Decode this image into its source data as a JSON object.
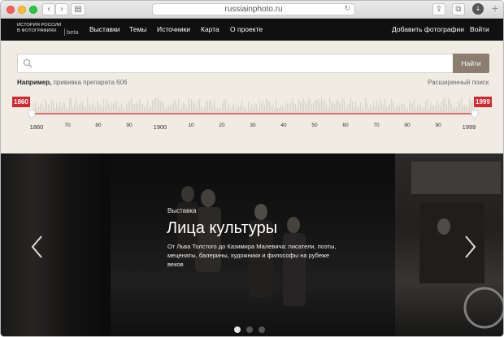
{
  "browser": {
    "url": "russiainphoto.ru",
    "back_icon": "chevron-left-icon",
    "forward_icon": "chevron-right-icon"
  },
  "header": {
    "logo_line1": "ИСТОРИЯ РОССИИ",
    "logo_line2": "В ФОТОГРАФИЯХ",
    "logo_beta": "beta",
    "nav": [
      "Выставки",
      "Темы",
      "Источники",
      "Карта",
      "О проекте"
    ],
    "add_photos": "Добавить фотографии",
    "login": "Войти"
  },
  "search": {
    "placeholder": "",
    "button": "Найти",
    "example_label": "Например,",
    "example_query": "прививка препарата 606",
    "advanced": "Расширенный поиск"
  },
  "timeline": {
    "start_year": "1860",
    "end_year": "1999",
    "range": [
      1860,
      1999
    ],
    "labels": [
      "1860",
      "70",
      "80",
      "90",
      "1900",
      "10",
      "20",
      "30",
      "40",
      "50",
      "60",
      "70",
      "80",
      "90",
      "1999"
    ],
    "accent": "#d8262f"
  },
  "hero": {
    "tag": "Выставка",
    "title": "Лица культуры",
    "description": "От Льва Толстого до Казимира Малевича: писатели, поэты, меценаты, балерины, художники и философы на рубеже веков",
    "slides": 3,
    "active_slide": 1
  }
}
